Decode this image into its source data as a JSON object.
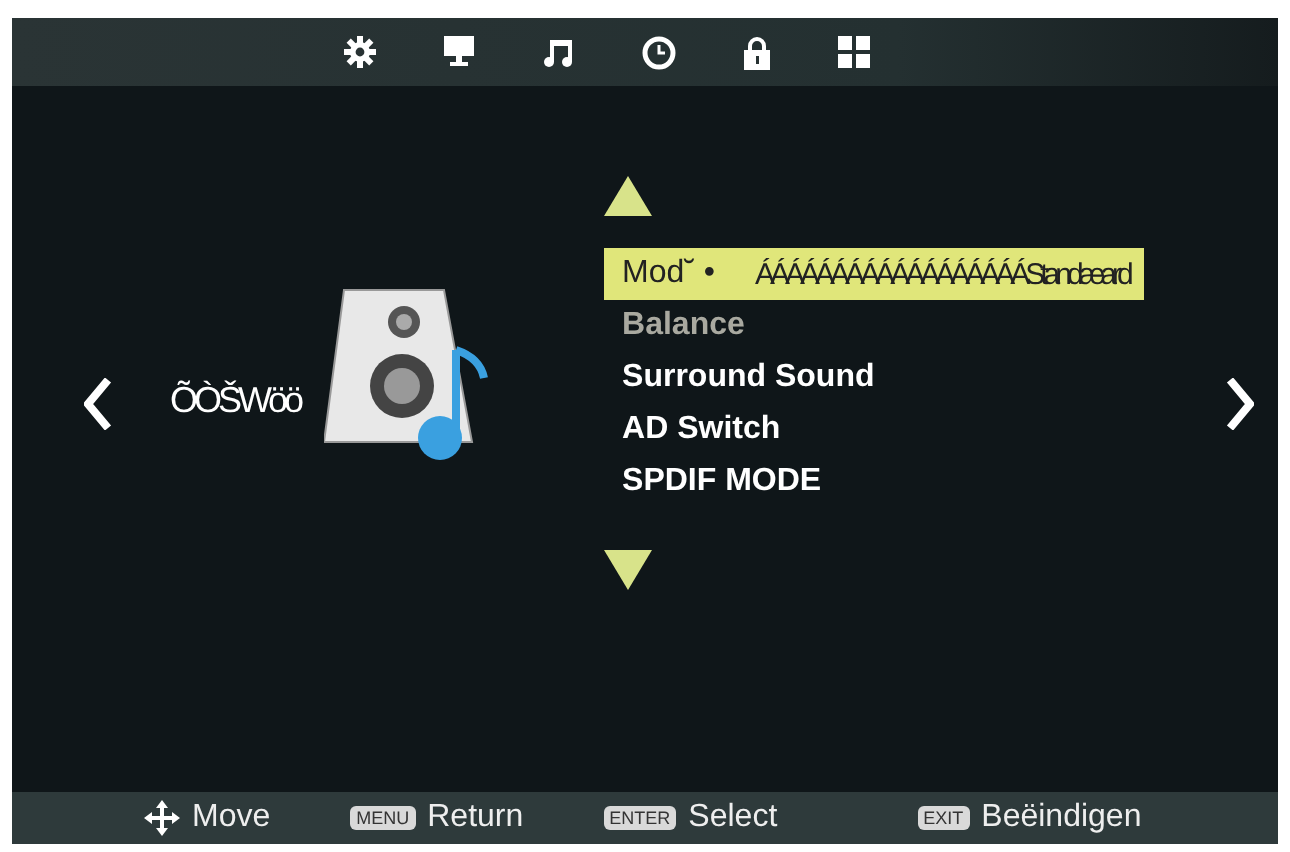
{
  "page": {
    "title": "ÕÒŠWöö"
  },
  "menu": {
    "items": [
      {
        "label": "Mod˘ •",
        "value": "ÁÁÁÁÁÁÁÁÁÁÁÁÁÁÁÁÁÁStandæard",
        "selected": true,
        "disabled": false
      },
      {
        "label": "Balance",
        "selected": false,
        "disabled": true
      },
      {
        "label": "Surround Sound",
        "selected": false,
        "disabled": false
      },
      {
        "label": "AD Switch",
        "selected": false,
        "disabled": false
      },
      {
        "label": "SPDIF MODE",
        "selected": false,
        "disabled": false
      }
    ]
  },
  "footer": [
    {
      "kind": "icon",
      "label": "Move"
    },
    {
      "kind": "key",
      "key": "MENU",
      "label": "Return"
    },
    {
      "kind": "key",
      "key": "ENTER",
      "label": "Select"
    },
    {
      "kind": "key",
      "key": "EXIT",
      "label": "Beëindigen"
    }
  ]
}
